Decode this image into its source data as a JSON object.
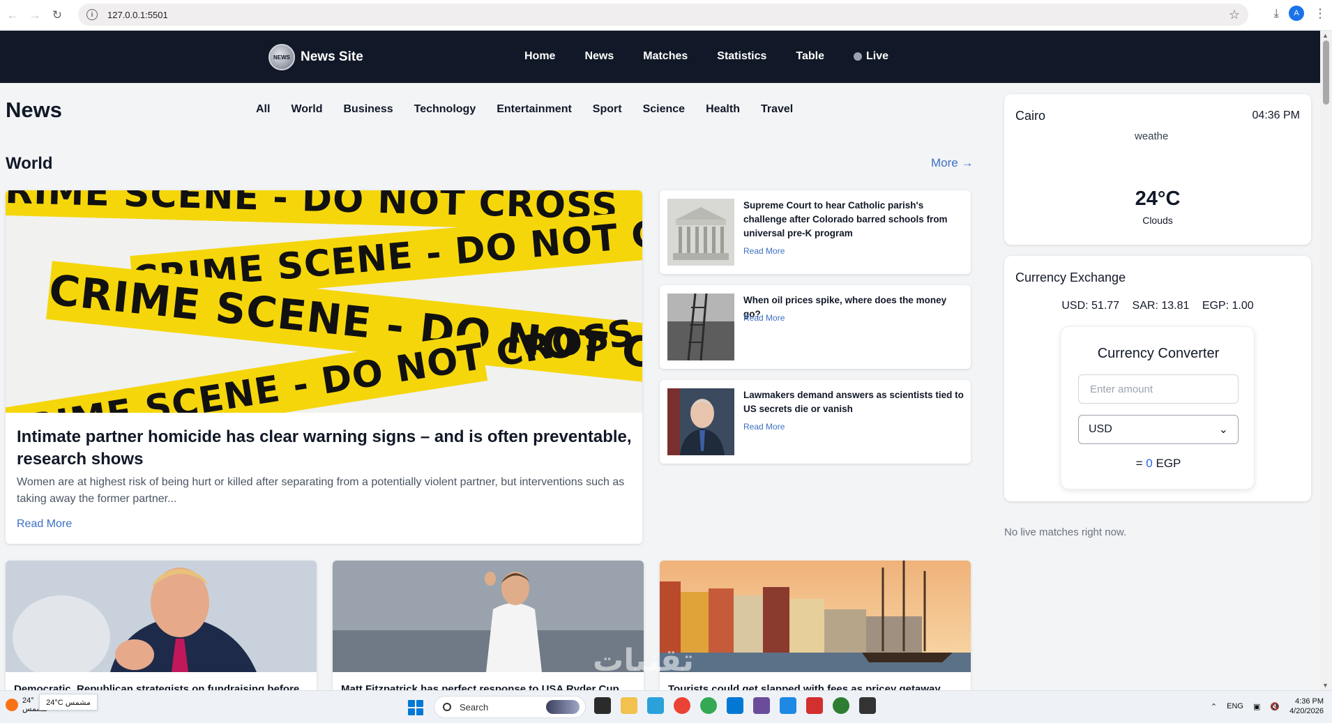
{
  "browser": {
    "url": "127.0.0.1:5501",
    "avatar_letter": "A"
  },
  "header": {
    "brand_logo_text": "NEWS",
    "brand": "News Site",
    "nav": [
      "Home",
      "News",
      "Matches",
      "Statistics",
      "Table",
      "Live"
    ]
  },
  "page": {
    "title": "News",
    "categories": [
      "All",
      "World",
      "Business",
      "Technology",
      "Entertainment",
      "Sport",
      "Science",
      "Health",
      "Travel"
    ],
    "section_title": "World",
    "more_link": "More →"
  },
  "featured": {
    "image_text": [
      "CRIME SCENE - DO NOT CROSS",
      "CRIME SCENE - DO NOT CROSS",
      "CRIME SCENE - DO NOT CROSS",
      "CRIME SCENE - DO NOT CROSS"
    ],
    "title": "Intimate partner homicide has clear warning signs – and is often preventable, research shows",
    "description": "Women are at highest risk of being hurt or killed after separating from a potentially violent partner, but interventions such as taking away the former partner...",
    "read_more": "Read More"
  },
  "side_articles": [
    {
      "title": "Supreme Court to hear Catholic parish's challenge after Colorado barred schools from universal pre-K program",
      "read_more": "Read More"
    },
    {
      "title": "When oil prices spike, where does the money go?",
      "read_more": "Read More"
    },
    {
      "title": "Lawmakers demand answers as scientists tied to US secrets die or vanish",
      "read_more": "Read More"
    }
  ],
  "bottom_articles": [
    {
      "title": "Democratic, Republican strategists on fundraising before"
    },
    {
      "title": "Matt Fitzpatrick has perfect response to USA Ryder Cup"
    },
    {
      "title": "Tourists could get slapped with fees as pricey getaway"
    }
  ],
  "weather": {
    "city": "Cairo",
    "time": "04:36 PM",
    "icon_alt": "weathe",
    "temperature": "24°C",
    "condition": "Clouds"
  },
  "currency": {
    "title": "Currency Exchange",
    "rates": [
      "USD: 51.77",
      "SAR: 13.81",
      "EGP: 1.00"
    ],
    "converter": {
      "title": "Currency Converter",
      "amount_placeholder": "Enter amount",
      "selected_currency": "USD",
      "result_prefix": "=",
      "result_value": "0",
      "result_currency": "EGP"
    }
  },
  "live": {
    "message": "No live matches right now."
  },
  "watermark": "تقنيات",
  "taskbar": {
    "weather_temp": "24°",
    "weather_sub": "مشمس",
    "tooltip": "24°C مشمس",
    "search_placeholder": "Search",
    "language": "ENG",
    "time": "4:36 PM",
    "date": "4/20/2026"
  },
  "colors": {
    "header_bg": "#111827",
    "link": "#3b6fc4",
    "converter_result": "#2563eb",
    "tape_yellow": "#f5d60b"
  }
}
